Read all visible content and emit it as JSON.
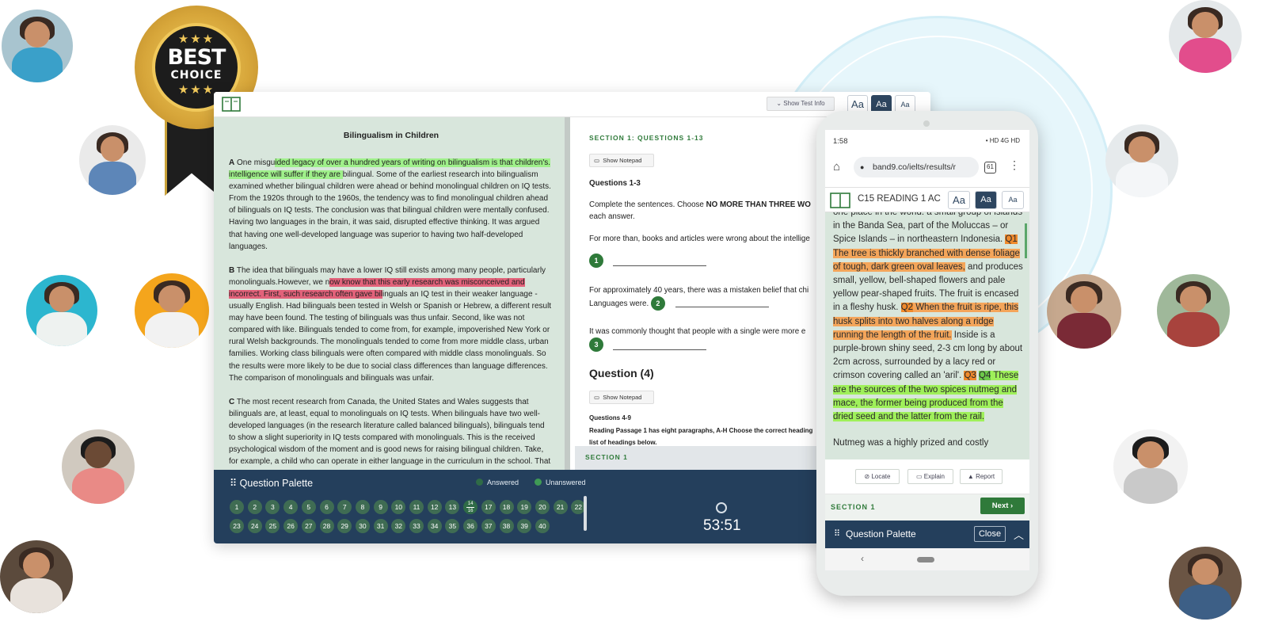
{
  "badge": {
    "stars": "★★★",
    "line1": "BEST",
    "line2": "CHOICE"
  },
  "desktop": {
    "show_test_info": "Show Test Info",
    "font_buttons": [
      "Aa",
      "Aa",
      "Aa"
    ],
    "passage": {
      "title": "Bilingualism in Children",
      "para_a": {
        "letter": "A",
        "pre": "One misgu",
        "hl": "ided legacy of over a hundred years of writing on bilingualism is that children's. intelligence will suffer if they are ",
        "post": "bilingual. Some of the earliest research into bilingualism examined whether bilingual children were ahead or behind monolingual children on IQ tests. From the 1920s through to the 1960s, the tendency was to find monolingual children ahead of bilinguals on IQ tests. The conclusion was that bilingual children were mentally confused. Having two languages in the brain, it was said, disrupted effective thinking. It was argued that having one well-developed language was superior to having two half-developed languages."
      },
      "para_b": {
        "letter": "B",
        "pre": "The idea that bilinguals may have a lower IQ still exists among many people, particularly monolinguals.However, we n",
        "hl": "ow know that this early research was misconceived and incorrect. First, such research often gave bil",
        "post": "inguals an IQ test in their weaker language - usually English. Had bilinguals been tested in Welsh or Spanish or Hebrew, a different result may have been found. The testing of bilinguals was thus unfair. Second, like was not compared with like. Bilinguals tended to come from, for example, impoverished New York or rural Welsh backgrounds. The monolinguals tended to come from more middle class, urban families. Working class bilinguals were often compared with middle class monolinguals. So the results were more likely to be due to social class differences than language differences. The comparison of monolinguals and bilinguals was unfair."
      },
      "para_c": {
        "letter": "C",
        "text": "The most recent research from Canada, the United States and Wales suggests that bilinguals are, at least, equal to monolinguals on IQ tests. When bilinguals have two well-developed languages (in the research literature called balanced bilinguals), bilinguals tend to show a slight superiority in IQ tests compared with monolinguals. This is the received psychological wisdom of the moment and is good news for raising bilingual children. Take, for example, a child who can operate in either language in the curriculum in the school. That"
      }
    },
    "questions": {
      "section_title": "SECTION 1: QUESTIONS 1-13",
      "show_notepad": "Show Notepad",
      "group_title": "Questions 1-3",
      "instr_pre": "Complete the sentences. Choose ",
      "instr_bold": "NO MORE THAN THREE WO",
      "instr_post": "each answer.",
      "q1_text": "For more than, books and articles were wrong about the intellige",
      "q2_text_a": "For approximately 40 years, there was a mistaken belief that chi",
      "q2_text_b": "Languages were.",
      "q3_text": "It was commonly thought that people with a single were more e",
      "nums": [
        "1",
        "2",
        "3"
      ],
      "q4_heading": "Question (4)",
      "show_notepad_2": "Show Notepad",
      "q4_title": "Questions 4-9",
      "q4_instr_a": "Reading Passage 1 has eight paragraphs, A-H Choose the correct heading",
      "q4_instr_b": "list of headings below.",
      "section_bar": "SECTION 1"
    },
    "palette": {
      "title": "Question Palette",
      "answered": "Answered",
      "unanswered": "Unanswered",
      "row1": [
        "1",
        "2",
        "3",
        "4",
        "5",
        "6",
        "7",
        "8",
        "9",
        "10",
        "11",
        "12",
        "13",
        "14/16",
        "17",
        "18",
        "19",
        "20",
        "21",
        "22"
      ],
      "row2": [
        "23",
        "24",
        "25",
        "26",
        "27",
        "28",
        "29",
        "30",
        "31",
        "32",
        "33",
        "34",
        "35",
        "36",
        "37",
        "38",
        "39",
        "40"
      ],
      "timer": "53:51",
      "answered_color": "#2f6b47",
      "unanswered_color": "#3f9a55"
    }
  },
  "phone": {
    "time": "1:58",
    "status_right": "• HD 4G HD",
    "url": "band9.co/ielts/results/r",
    "tab_count": "61",
    "app_title": "C15 READING 1 AC",
    "font_buttons": [
      "Aa",
      "Aa",
      "Aa"
    ],
    "passage": {
      "s0": "one place in the world: a small group of islands in the Banda Sea, part of the Moluccas – or Spice Islands – in northeastern Indonesia. ",
      "q1_label": "Q1",
      "q1_text": " The tree is thickly branched with dense foliage of tough, dark green oval leaves,",
      "s1": " and produces small, yellow, bell-shaped flowers and pale yellow pear-shaped fruits. The fruit is encased in a fleshy husk. ",
      "q2_label": "Q2",
      "q2_text": " When the fruit is ripe, this husk splits into two halves along a ridge running the length of the fruit.",
      "s2": " Inside is a purple-brown shiny seed, 2-3 cm long by about 2cm across, surrounded by a lacy red or crimson covering called an 'aril'. ",
      "q3_label": "Q3",
      "q4_label": "Q4",
      "q4_text": " These  are the sources of the two spices nutmeg and mace, the former being produced from the dried seed and the latter from the rail.",
      "s3": "Nutmeg was a highly prized and costly"
    },
    "tools": [
      "Locate",
      "Explain",
      "Report"
    ],
    "section_label": "SECTION 1",
    "next": "Next",
    "palette_title": "Question Palette",
    "close": "Close"
  }
}
